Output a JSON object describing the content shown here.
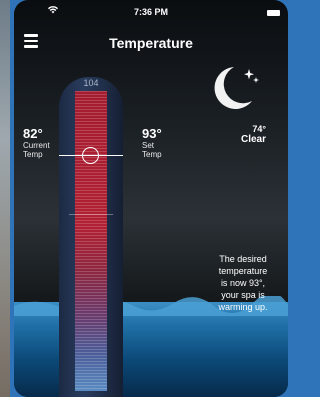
{
  "status_bar": {
    "time": "7:36 PM"
  },
  "header": {
    "title": "Temperature"
  },
  "weather": {
    "temp": "74°",
    "condition": "Clear"
  },
  "current": {
    "value": "82°",
    "label_line1": "Current",
    "label_line2": "Temp"
  },
  "set": {
    "value": "93°",
    "label_line1": "Set",
    "label_line2": "Temp"
  },
  "thermometer": {
    "scale_top": "104"
  },
  "message": {
    "line1": "The desired",
    "line2": "temperature",
    "line3": "is now 93°,",
    "line4": "your spa is",
    "line5": "warming up."
  },
  "icons": [
    "wifi-icon",
    "battery-icon",
    "menu-icon",
    "moon-stars-icon"
  ]
}
